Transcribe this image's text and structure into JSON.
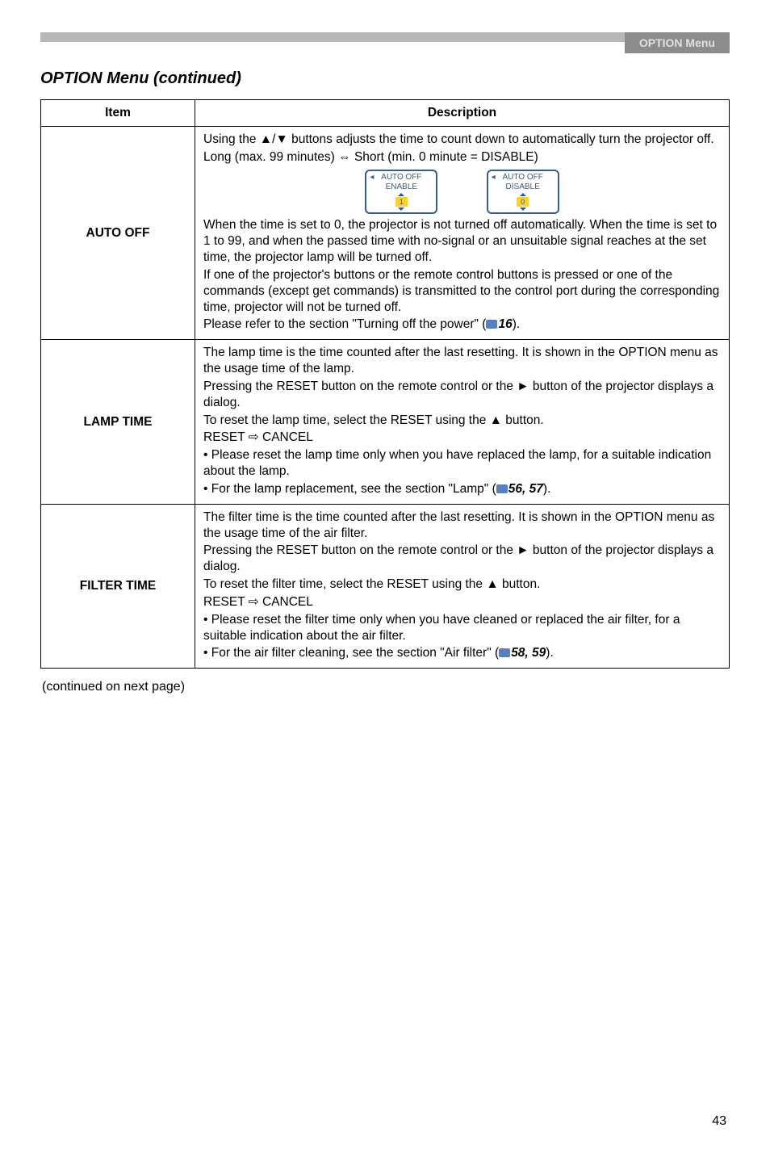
{
  "header": {
    "tab": "OPTION Menu"
  },
  "section_title": "OPTION Menu (continued)",
  "table": {
    "headers": {
      "item": "Item",
      "description": "Description"
    },
    "rows": {
      "auto_off": {
        "item": "AUTO OFF",
        "p1": "Using the ▲/▼ buttons adjusts the time to count down to automatically turn the projector off.",
        "p2": "Long (max. 99 minutes) ⇔ Short (min. 0 minute = DISABLE)",
        "badge1_title": "AUTO OFF",
        "badge1_sub": "ENABLE",
        "badge1_num": "1",
        "badge2_title": "AUTO OFF",
        "badge2_sub": "DISABLE",
        "badge2_num": "0",
        "p3": "When the time is set to 0, the projector is not turned off automatically. When the time is set to 1 to 99, and when the passed time with no-signal or an unsuitable signal reaches at the set time, the projector lamp will be turned off.",
        "p4a": "If one of the projector's buttons or the remote control buttons is pressed or one of the commands (except get commands) is transmitted to the control port during the corresponding time, projector will not be turned off.",
        "p4b_prefix": "Please refer to the section \"Turning off the power\" (",
        "p4b_ref": "16",
        "p4b_suffix": ")."
      },
      "lamp_time": {
        "item": "LAMP TIME",
        "p1": "The lamp time is the time counted after the last resetting. It is shown in the OPTION menu as the usage time of the lamp.",
        "p2": "Pressing the RESET button on the remote control or the ► button of the projector displays a dialog.",
        "p3": "To reset the lamp time, select the RESET using the ▲ button.",
        "p4": "RESET ⇨ CANCEL",
        "p5": "• Please reset the lamp time only when you have replaced the lamp, for a suitable indication about the lamp.",
        "p6_prefix": "• For the lamp replacement, see the section \"Lamp\" (",
        "p6_ref": "56, 57",
        "p6_suffix": ")."
      },
      "filter_time": {
        "item": "FILTER TIME",
        "p1": "The filter time is the time counted after the last resetting. It is shown in the OPTION menu as the usage time of the air filter.",
        "p2": "Pressing the RESET button on the remote control or the ► button of the projector displays a dialog.",
        "p3": "To reset the filter time, select the RESET using the ▲ button.",
        "p4": "RESET ⇨ CANCEL",
        "p5": "• Please reset the filter time only when you have cleaned or replaced the air filter, for a suitable indication about the air filter.",
        "p6_prefix": "• For the air filter cleaning, see the section \"Air filter\" (",
        "p6_ref": "58, 59",
        "p6_suffix": ")."
      }
    }
  },
  "continued": "(continued on next page)",
  "page_number": "43"
}
